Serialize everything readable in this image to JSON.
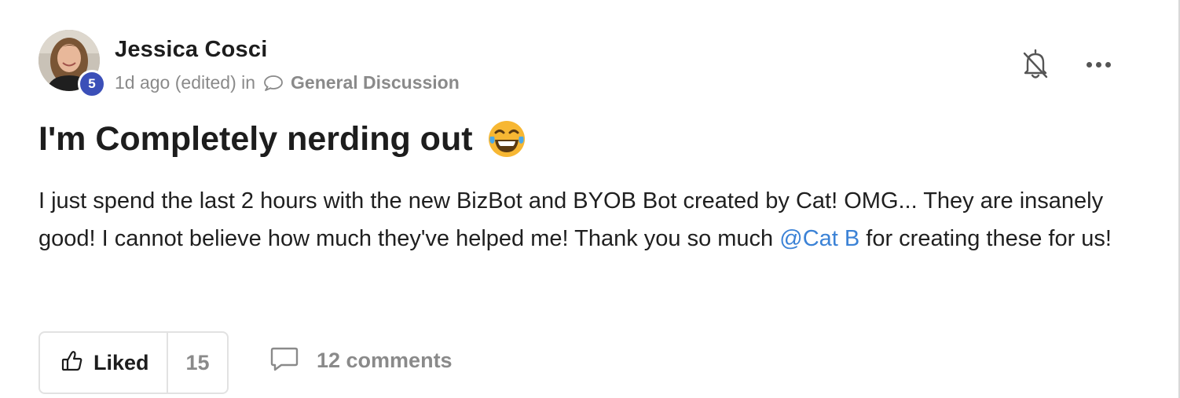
{
  "post": {
    "author": {
      "name": "Jessica Cosci",
      "level": "5"
    },
    "meta": {
      "time": "1d ago (edited) in",
      "category": "General Discussion"
    },
    "title": "I'm Completely nerding out",
    "title_emoji": "laughing-tears-emoji",
    "body": {
      "text_before_mention": "I just spend the last 2 hours with the new BizBot and BYOB Bot created by Cat! OMG... They are insanely good! I cannot believe how much they've helped me! Thank you so much ",
      "mention": "@Cat B",
      "text_after_mention": " for creating these for us!"
    },
    "actions": {
      "like_label": "Liked",
      "like_count": "15",
      "comments_label": "12 comments"
    },
    "icons": {
      "bell": "bell-off-icon",
      "more": "more-horizontal-icon",
      "like": "thumbs-up-icon",
      "comment": "comment-icon",
      "category": "chat-bubble-icon"
    },
    "colors": {
      "level_badge": "#3b4fb8",
      "mention": "#3b82d6",
      "muted_text": "#8a8a8a"
    }
  }
}
